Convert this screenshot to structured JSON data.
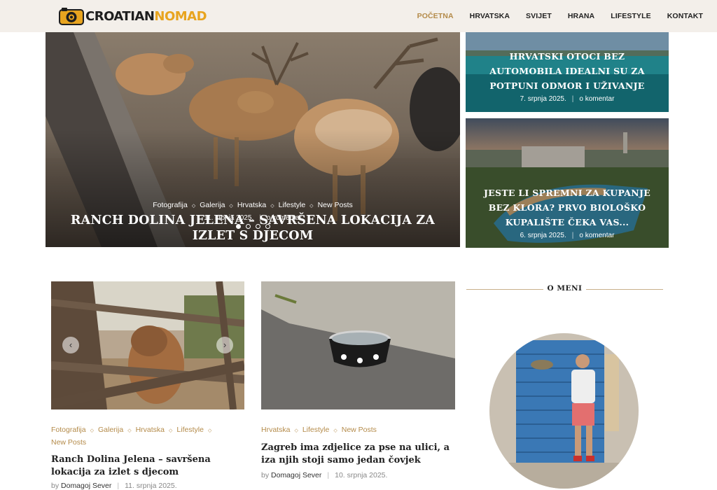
{
  "brand": {
    "part1": "CROATIAN",
    "part2": "NOMAD"
  },
  "nav": [
    {
      "label": "POČETNA",
      "active": true
    },
    {
      "label": "HRVATSKA",
      "active": false
    },
    {
      "label": "SVIJET",
      "active": false
    },
    {
      "label": "HRANA",
      "active": false
    },
    {
      "label": "LIFESTYLE",
      "active": false
    },
    {
      "label": "KONTAKT",
      "active": false
    }
  ],
  "hero": {
    "categories": [
      "Fotografija",
      "Galerija",
      "Hrvatska",
      "Lifestyle",
      "New Posts"
    ],
    "title": "RANCH DOLINA JELENA – SAVRŠENA LOKACIJA ZA IZLET S DJECOM",
    "date": "11. srpnja 2025.",
    "comments": "o komentar",
    "slides": 4,
    "active_slide": 1
  },
  "side": [
    {
      "title": "HRVATSKI OTOCI BEZ AUTOMOBILA IDEALNI SU ZA POTPUNI ODMOR I UŽIVANJE",
      "date": "7. srpnja 2025.",
      "comments": "o komentar"
    },
    {
      "title": "JESTE LI SPREMNI ZA KUPANJE BEZ KLORA? PRVO BIOLOŠKO KUPALIŠTE ČEKA VAS...",
      "date": "6. srpnja 2025.",
      "comments": "o komentar"
    }
  ],
  "posts": [
    {
      "categories": [
        "Fotografija",
        "Galerija",
        "Hrvatska",
        "Lifestyle",
        "New Posts"
      ],
      "title": "Ranch Dolina Jelena – savršena lokacija za izlet s djecom",
      "by": "by",
      "author": "Domagoj Sever",
      "date": "11. srpnja 2025."
    },
    {
      "categories": [
        "Hrvatska",
        "Lifestyle",
        "New Posts"
      ],
      "title": "Zagreb ima zdjelice za pse na ulici, a iza njih stoji samo jedan čovjek",
      "by": "by",
      "author": "Domagoj Sever",
      "date": "10. srpnja 2025."
    }
  ],
  "widget": {
    "title": "O MENI"
  },
  "colors": {
    "accent": "#b48b4a",
    "header_bg": "#f3efea",
    "logo_yellow": "#e8a41f"
  },
  "icons": {
    "prev": "chevron-left-icon",
    "next": "chevron-right-icon",
    "logo": "camera-icon"
  }
}
